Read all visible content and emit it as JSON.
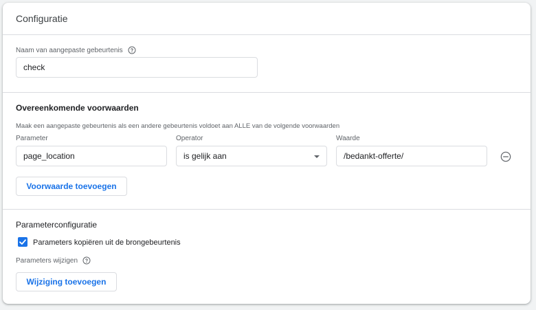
{
  "header": {
    "title": "Configuratie"
  },
  "event_name": {
    "label": "Naam van aangepaste gebeurtenis",
    "value": "check",
    "help_icon": "help-circle-icon"
  },
  "conditions": {
    "title": "Overeenkomende voorwaarden",
    "description": "Maak een aangepaste gebeurtenis als een andere gebeurtenis voldoet aan ALLE van de volgende voorwaarden",
    "columns": {
      "parameter": "Parameter",
      "operator": "Operator",
      "value": "Waarde"
    },
    "row": {
      "parameter": "page_location",
      "operator": "is gelijk aan",
      "value": "/bedankt-offerte/",
      "remove_icon": "remove-circle-icon"
    },
    "add_button": "Voorwaarde toevoegen"
  },
  "param_config": {
    "title": "Parameterconfiguratie",
    "copy_checkbox": {
      "label": "Parameters kopiëren uit de brongebeurtenis",
      "checked": true
    },
    "modify_label": "Parameters wijzigen",
    "help_icon": "help-circle-icon",
    "add_button": "Wijziging toevoegen"
  },
  "colors": {
    "accent": "#1a73e8",
    "border": "#dadce0",
    "muted_text": "#5f6368"
  }
}
